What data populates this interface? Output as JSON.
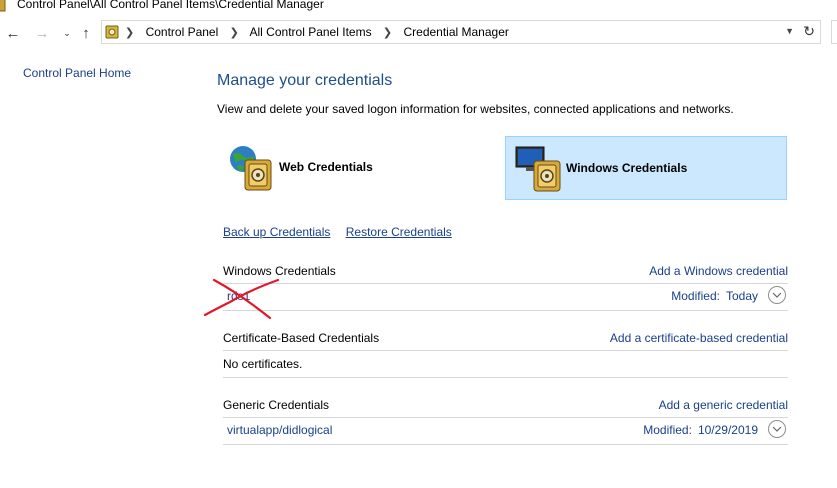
{
  "window": {
    "title": "Control Panel\\All Control Panel Items\\Credential Manager"
  },
  "address": {
    "crumbs": [
      "Control Panel",
      "All Control Panel Items",
      "Credential Manager"
    ]
  },
  "sidebar": {
    "home_link": "Control Panel Home"
  },
  "main": {
    "heading": "Manage your credentials",
    "subtitle": "View and delete your saved logon information for websites, connected applications and networks.",
    "tiles": {
      "web": "Web Credentials",
      "windows": "Windows Credentials"
    },
    "actions": {
      "backup": "Back up Credentials",
      "restore": "Restore Credentials"
    },
    "sections": {
      "windows": {
        "title": "Windows Credentials",
        "add": "Add a Windows credential",
        "items": [
          {
            "name": "rds1",
            "modified_label": "Modified:",
            "modified_value": "Today"
          }
        ]
      },
      "certificate": {
        "title": "Certificate-Based Credentials",
        "add": "Add a certificate-based credential",
        "empty": "No certificates."
      },
      "generic": {
        "title": "Generic Credentials",
        "add": "Add a generic credential",
        "items": [
          {
            "name": "virtualapp/didlogical",
            "modified_label": "Modified:",
            "modified_value": "10/29/2019"
          }
        ]
      }
    }
  },
  "colors": {
    "link": "#1a3f8c",
    "heading": "#1e4e8c",
    "selected_tile": "#cce8ff",
    "scribble": "#e2182a"
  },
  "icons": [
    "control-panel-icon",
    "back-arrow-icon",
    "forward-arrow-icon",
    "recent-dropdown-icon",
    "up-arrow-icon",
    "chevron-right-icon",
    "refresh-icon",
    "globe-vault-icon",
    "monitor-vault-icon",
    "chevron-down-circle-icon"
  ]
}
